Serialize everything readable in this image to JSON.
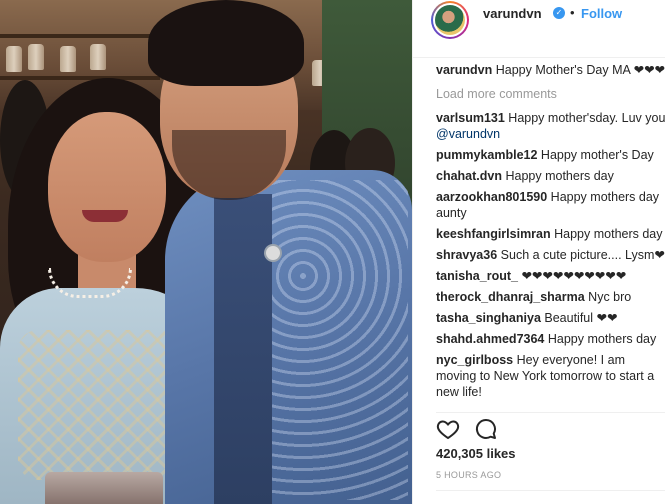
{
  "post": {
    "username": "varundvn",
    "follow_label": "Follow",
    "separator": "•",
    "verified_glyph": "✓",
    "caption_text": "Happy Mother's Day MA ❤❤❤",
    "load_more": "Load more comments",
    "likes": "420,305 likes",
    "timestamp": "5 HOURS AGO"
  },
  "comments": [
    {
      "user": "varlsum131",
      "text": "Happy mother'sday. Luv you",
      "mention": "@varundvn"
    },
    {
      "user": "pummykamble12",
      "text": "Happy mother's Day"
    },
    {
      "user": "chahat.dvn",
      "text": "Happy mothers day"
    },
    {
      "user": "aarzookhan801590",
      "text": "Happy mothers day aunty"
    },
    {
      "user": "keeshfangirlsimran",
      "text": "Happy mothers day"
    },
    {
      "user": "shravya36",
      "text": "Such a cute picture.... Lysm❤❤"
    },
    {
      "user": "tanisha_rout_",
      "text": "❤❤❤❤❤❤❤❤❤❤"
    },
    {
      "user": "therock_dhanraj_sharma",
      "text": "Nyc bro"
    },
    {
      "user": "tasha_singhaniya",
      "text": "Beautiful ❤❤"
    },
    {
      "user": "shahd.ahmed7364",
      "text": "Happy mothers day"
    },
    {
      "user": "nyc_girlboss",
      "text": "Hey everyone! I am moving to New York tomorrow to start a new life!"
    }
  ],
  "icons": {
    "like": "heart-icon",
    "comment": "comment-bubble-icon",
    "verified": "verified-badge-icon"
  },
  "colors": {
    "accent": "#3897f0",
    "text": "#262626",
    "muted": "#999999"
  }
}
